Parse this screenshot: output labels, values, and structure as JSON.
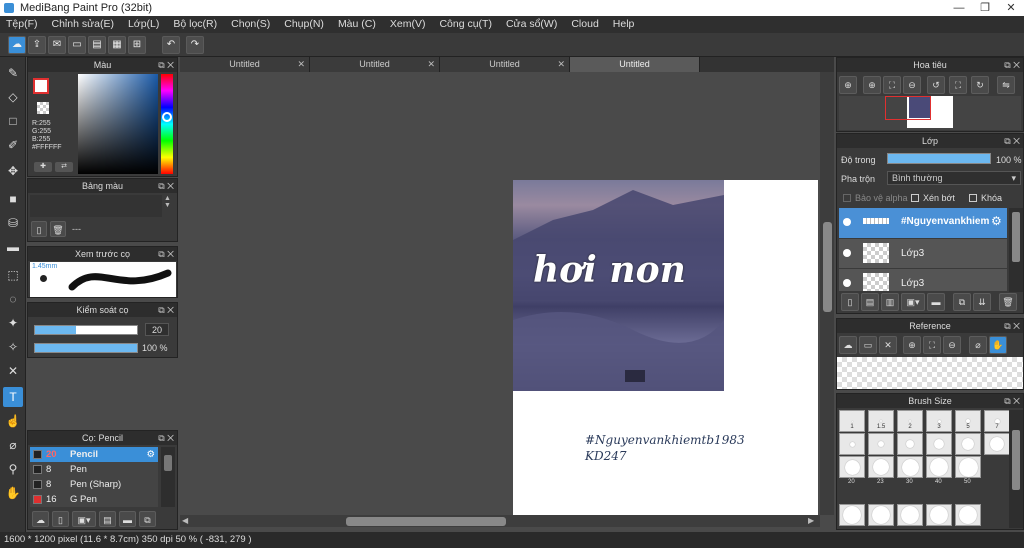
{
  "window": {
    "title": "MediBang Paint Pro (32bit)"
  },
  "menu": [
    "Tệp(F)",
    "Chỉnh sửa(E)",
    "Lớp(L)",
    "Bộ lọc(R)",
    "Chọn(S)",
    "Chụp(N)",
    "Màu (C)",
    "Xem(V)",
    "Công cụ(T)",
    "Cửa sổ(W)",
    "Cloud",
    "Help"
  ],
  "tabs": [
    "Untitled",
    "Untitled",
    "Untitled",
    "Untitled"
  ],
  "color_panel": {
    "title": "Màu",
    "r": "R:255",
    "g": "G:255",
    "b": "B:255",
    "hex": "#FFFFFF",
    "primary": "#ffffff",
    "accent": "#e03030"
  },
  "palette_panel": {
    "title": "Bảng màu",
    "value": "---"
  },
  "brush_preview": {
    "title": "Xem trước cọ",
    "size": "1.45mm"
  },
  "brush_control": {
    "title": "Kiểm soát cọ",
    "size": "20",
    "opacity": "100 %"
  },
  "brush_list": {
    "title": "Cọ: Pencil",
    "items": [
      {
        "size": "20",
        "name": "Pencil",
        "color": "#222222"
      },
      {
        "size": "8",
        "name": "Pen",
        "color": "#222222"
      },
      {
        "size": "8",
        "name": "Pen (Sharp)",
        "color": "#222222"
      },
      {
        "size": "16",
        "name": "G Pen",
        "color": "#e03030"
      }
    ]
  },
  "navigator": {
    "title": "Hoa tiêu"
  },
  "layers": {
    "title": "Lớp",
    "opacity_label": "Độ trong",
    "opacity_value": "100 %",
    "blend_label": "Pha trộn",
    "blend_value": "Bình thường",
    "protect_alpha": "Bảo vệ alpha",
    "clipping": "Xén bớt",
    "lock": "Khóa",
    "items": [
      "#Nguyenvankhiem",
      "Lớp3",
      "Lớp3"
    ]
  },
  "reference": {
    "title": "Reference"
  },
  "brush_size": {
    "title": "Brush Size",
    "labels": [
      "1",
      "1.5",
      "2",
      "3",
      "5",
      "7",
      "20",
      "23",
      "30",
      "40",
      "50"
    ]
  },
  "canvas": {
    "text_main": "hơi non",
    "text_tag": "#Nguyenvankhiemtb1983",
    "text_sub": "KD247"
  },
  "status": {
    "text": "1600 * 1200 pixel   (11.6 * 8.7cm)   350 dpi   50 %   ( -831, 279 )"
  }
}
